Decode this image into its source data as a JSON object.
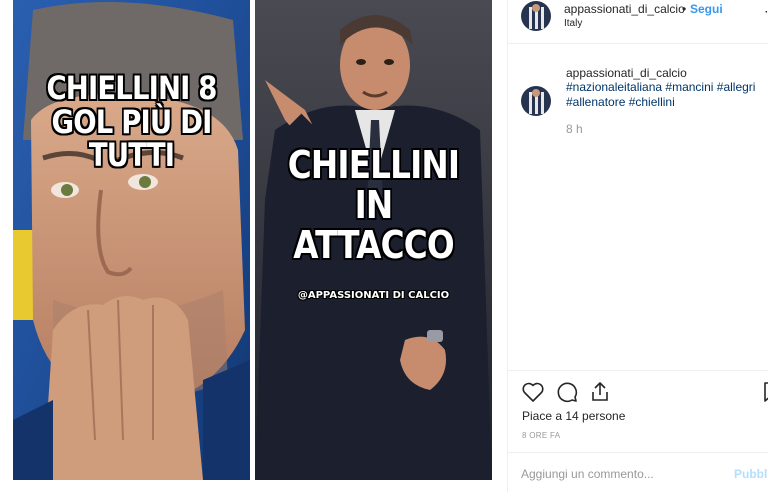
{
  "meme": {
    "left_caption": "CHIELLINI 8 GOL PIÙ DI TUTTI",
    "right_caption": "CHIELLINI IN ATTACCO",
    "watermark": "@APPASSIONATI DI CALCIO"
  },
  "post": {
    "username": "appassionati_di_calcio",
    "separator": "•",
    "follow_label": "Segui",
    "location": "Italy",
    "more_icon": "more-options-icon"
  },
  "caption": {
    "username": "appassionati_di_calcio",
    "hashtags": "#nazionaleitaliana #mancini #allegri #allenatore #chiellini",
    "time_ago": "8 h"
  },
  "actions": {
    "icons": [
      "heart-icon",
      "comment-icon",
      "share-icon",
      "bookmark-icon"
    ],
    "likes": "Piace a 14 persone",
    "post_time": "8 ORE FA"
  },
  "comment_box": {
    "placeholder": "Aggiungi un commento...",
    "publish_label": "Pubblica"
  },
  "colors": {
    "link": "#3897f0",
    "hashtag": "#003569",
    "muted": "#999999",
    "text": "#262626"
  }
}
